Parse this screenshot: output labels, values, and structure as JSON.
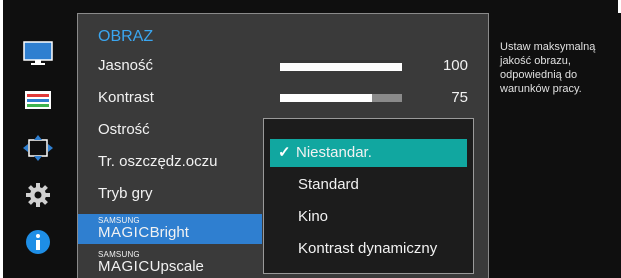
{
  "sidebar": {
    "icons": [
      "monitor-icon",
      "color-icon",
      "resize-icon",
      "settings-icon",
      "info-icon"
    ],
    "monitor_color": "#2f7fd0",
    "info_color": "#1e8ee6"
  },
  "menu": {
    "title": "OBRAZ",
    "items": [
      {
        "label": "Jasność",
        "value": "100",
        "level": 1.0
      },
      {
        "label": "Kontrast",
        "value": "75",
        "level": 0.75
      },
      {
        "label": "Ostrość"
      },
      {
        "label": "Tr. oszczędz.oczu"
      },
      {
        "label": "Tryb gry"
      },
      {
        "brand_small": "SAMSUNG",
        "brand_big": "MAGIC",
        "suffix": "Bright"
      },
      {
        "brand_small": "SAMSUNG",
        "brand_big": "MAGIC",
        "suffix": "Upscale"
      }
    ],
    "title_color": "#3aa6f0",
    "selected_color": "#2f7fd0"
  },
  "dropdown": {
    "options": [
      "Niestandar.",
      "Standard",
      "Kino",
      "Kontrast dynamiczny"
    ],
    "selected": "Niestandar.",
    "selected_color": "#11a7a0"
  },
  "help": {
    "text": "Ustaw maksymalną jakość obrazu, odpowiednią do warunków pracy."
  }
}
